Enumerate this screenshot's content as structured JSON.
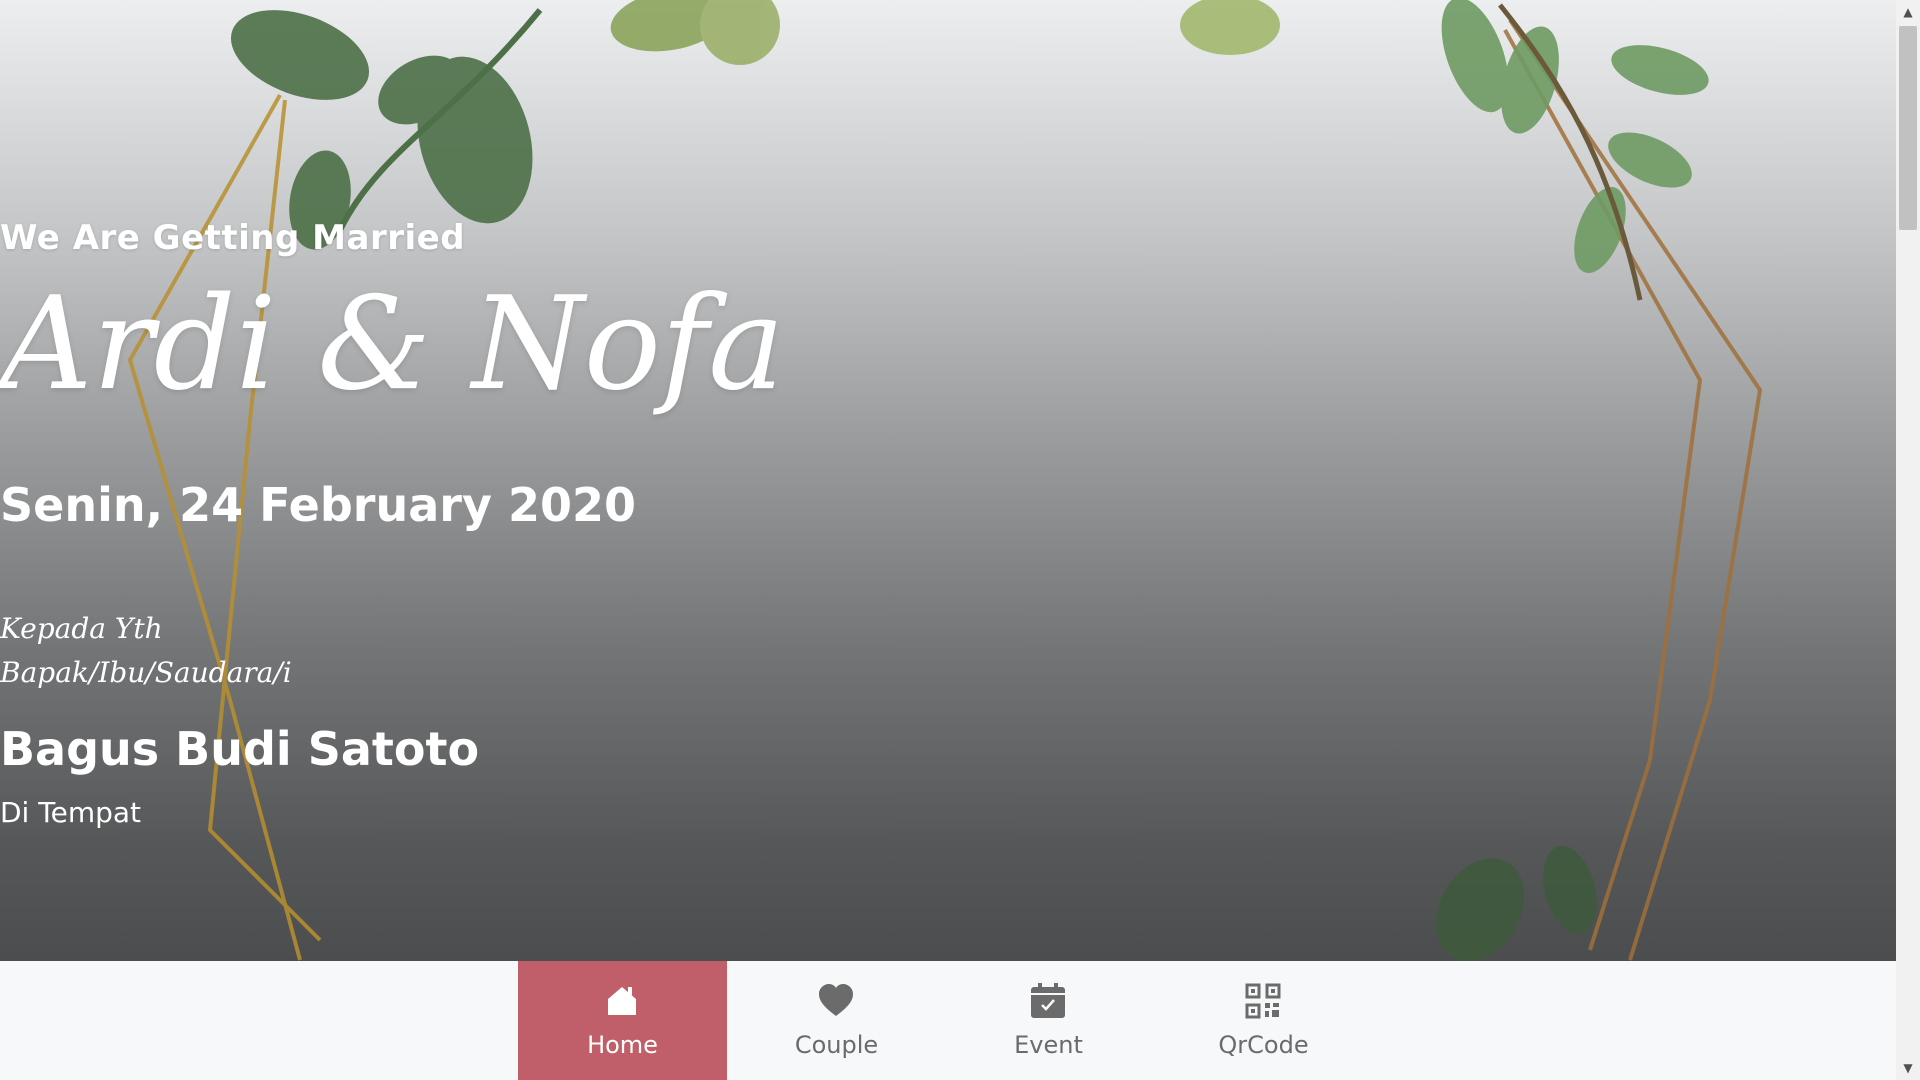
{
  "hero": {
    "subtitle": "We Are Getting Married",
    "couple_names": "Ardi & Nofa",
    "date": "Senin, 24 February 2020",
    "salutation_line1": "Kepada Yth",
    "salutation_line2": "Bapak/Ibu/Saudara/i",
    "guest_name": "Bagus Budi Satoto",
    "location_note": "Di Tempat"
  },
  "nav": {
    "items": [
      {
        "label": "Home",
        "icon": "home-icon",
        "active": true
      },
      {
        "label": "Couple",
        "icon": "heart-icon",
        "active": false
      },
      {
        "label": "Event",
        "icon": "calendar-icon",
        "active": false
      },
      {
        "label": "QrCode",
        "icon": "qrcode-icon",
        "active": false
      }
    ]
  },
  "colors": {
    "accent": "#c05f69",
    "nav_background": "#f7f8fa",
    "nav_text": "#6b6b6b",
    "leaf_green": "#4f7a4a",
    "frame_gold": "#b8902e"
  }
}
